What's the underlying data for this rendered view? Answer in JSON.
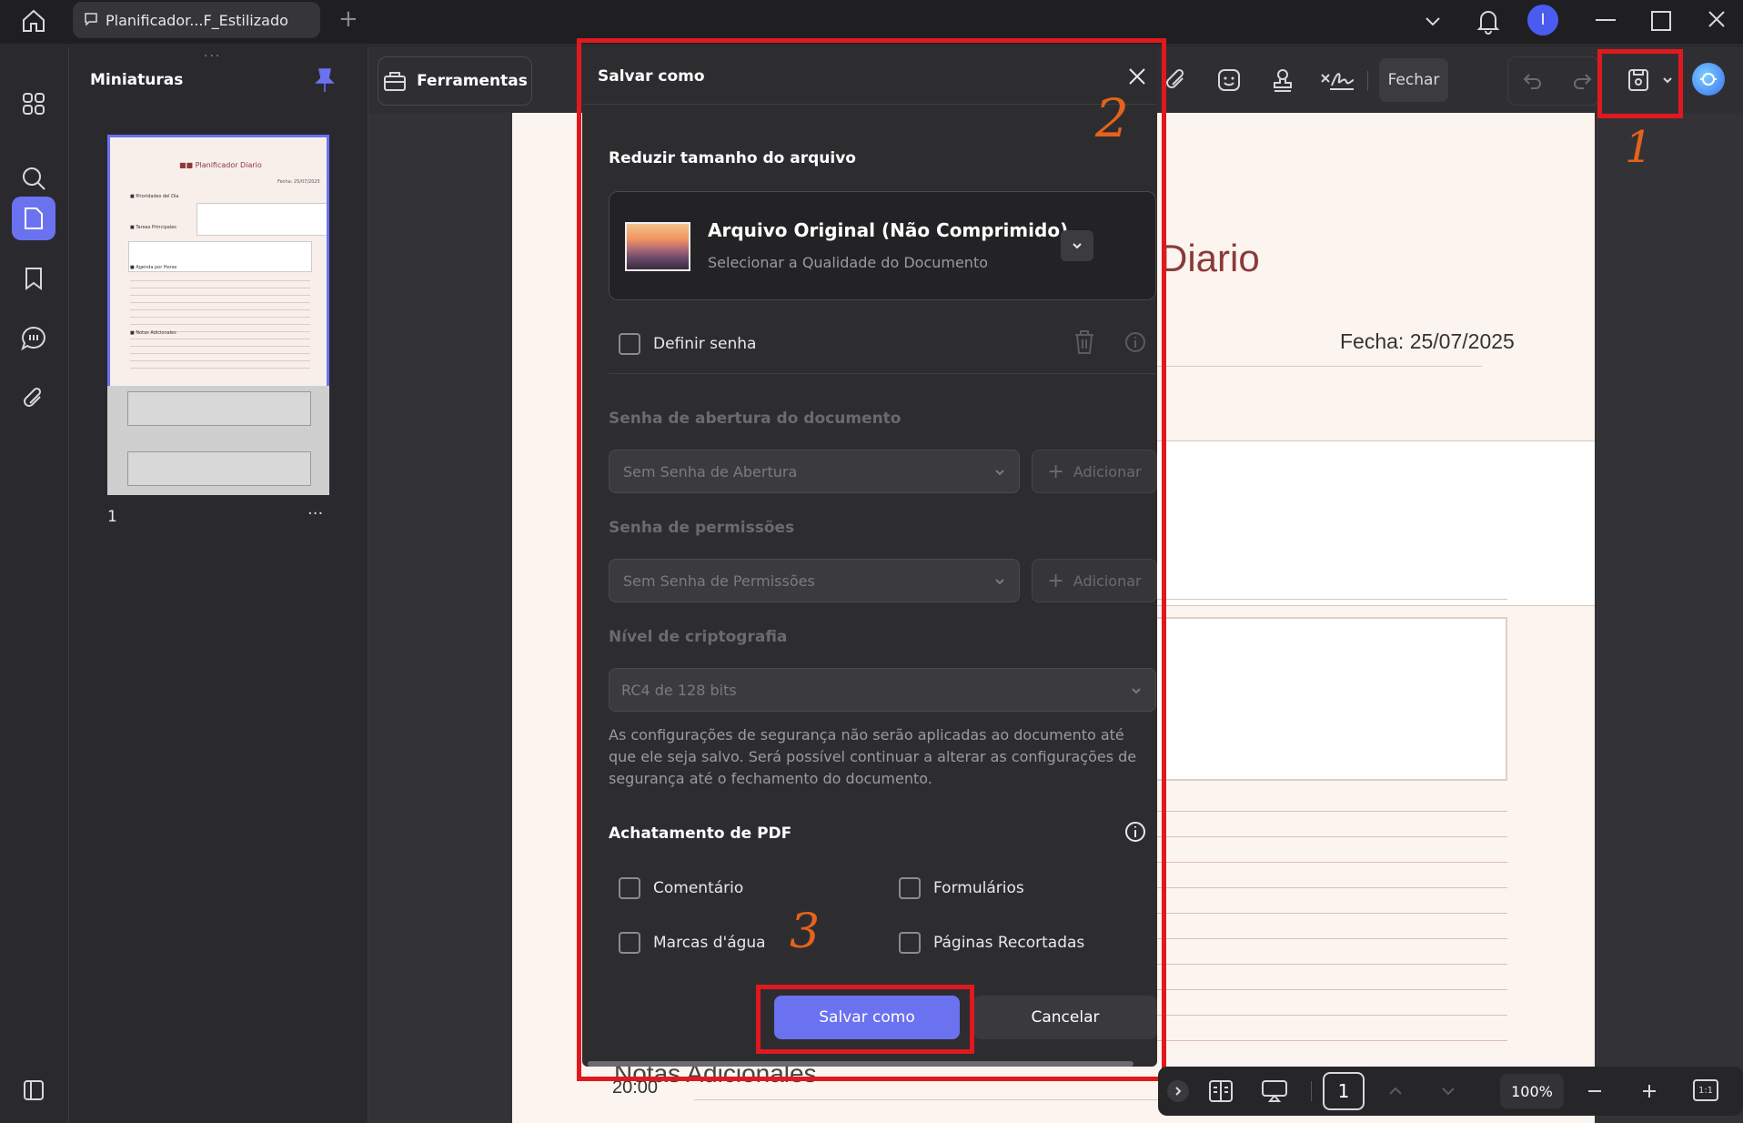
{
  "window": {
    "tab_title": "Planificador...F_Estilizado",
    "avatar_letter": "I"
  },
  "left_panel": {
    "title": "Miniaturas",
    "page_number": "1",
    "more": "···",
    "thumb": {
      "title": "Planificador Diario",
      "date": "Fecha: 25/07/2025",
      "section1": "Prioridades del Día",
      "section2": "Tareas Principales",
      "section3": "Agenda por Horas",
      "section4": "Notas Adicionales"
    }
  },
  "toolbar": {
    "tools_label": "Ferramentas",
    "close_label": "Fechar"
  },
  "document": {
    "title_fragment": "Diario",
    "date": "Fecha: 25/07/2025",
    "notes_fragment": "Notas Adicionales",
    "time": "20:00"
  },
  "dialog": {
    "title": "Salvar como",
    "reduce_title": "Reduzir tamanho do arquivo",
    "quality_main": "Arquivo Original (Não Comprimido)",
    "quality_sub": "Selecionar a Qualidade do Documento",
    "set_password": "Definir senha",
    "open_pw_title": "Senha de abertura do documento",
    "open_pw_value": "Sem Senha de Abertura",
    "add_label": "Adicionar",
    "perm_pw_title": "Senha de permissões",
    "perm_pw_value": "Sem Senha de Permissões",
    "encryption_title": "Nível de criptografia",
    "encryption_value": "RC4 de 128 bits",
    "security_note": "As configurações de segurança não serão aplicadas ao documento até que ele seja salvo. Será possível continuar a alterar as configurações de segurança até o fechamento do documento.",
    "flatten_title": "Achatamento de PDF",
    "opt_comment": "Comentário",
    "opt_forms": "Formulários",
    "opt_watermarks": "Marcas d'água",
    "opt_cropped": "Páginas Recortadas",
    "save_button": "Salvar como",
    "cancel_button": "Cancelar"
  },
  "annotations": {
    "step1": "1",
    "step2": "2",
    "step3": "3"
  },
  "bottombar": {
    "page_input": "1",
    "zoom": "100%",
    "fit_label": "1:1"
  },
  "colors": {
    "accent": "#6b72f0",
    "highlight_red": "#e0191e",
    "annotation_orange": "#e5621c"
  }
}
